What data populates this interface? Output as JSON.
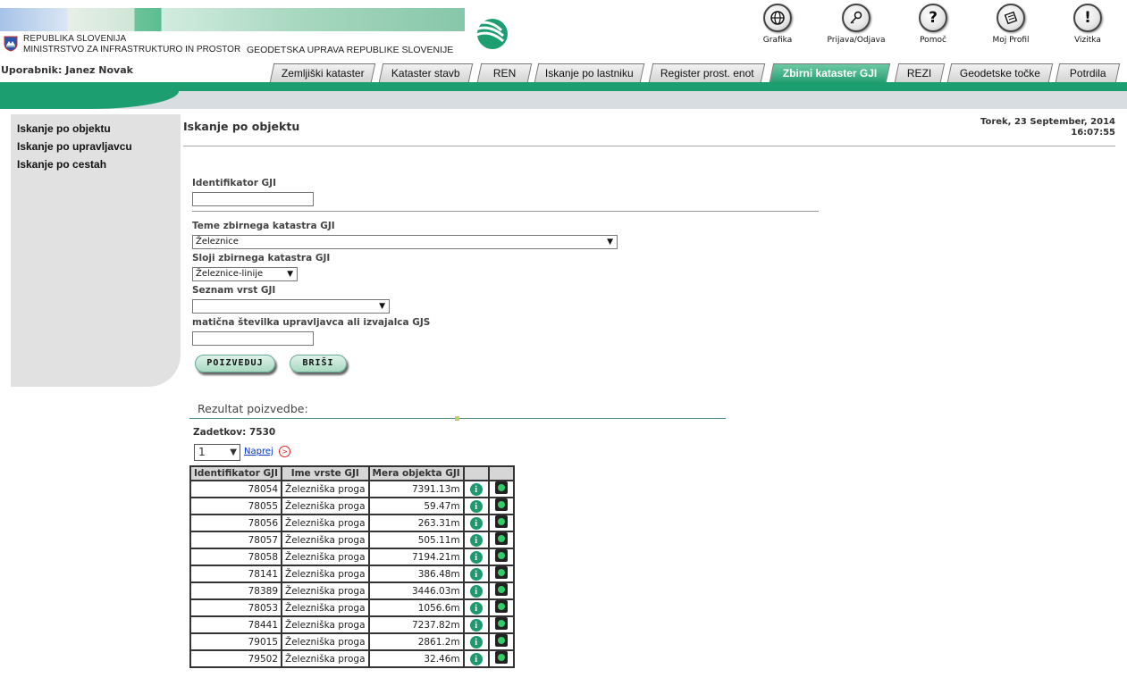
{
  "header": {
    "republic": "REPUBLIKA SLOVENIJA",
    "ministry": "MINISTRSTVO ZA INFRASTRUKTURO IN PROSTOR",
    "agency": "GEODETSKA UPRAVA REPUBLIKE SLOVENIJE",
    "top_icons": [
      {
        "label": "Grafika",
        "icon": "globe-icon"
      },
      {
        "label": "Prijava/Odjava",
        "icon": "key-icon"
      },
      {
        "label": "Pomoč",
        "icon": "help-icon",
        "glyph": "?"
      },
      {
        "label": "Moj Profil",
        "icon": "profile-icon"
      },
      {
        "label": "Vizitka",
        "icon": "info-icon",
        "glyph": "!"
      }
    ],
    "user": "Uporabnik: Janez Novak"
  },
  "tabs": [
    {
      "label": "Zemljiški kataster",
      "active": false
    },
    {
      "label": "Kataster stavb",
      "active": false
    },
    {
      "label": "REN",
      "active": false
    },
    {
      "label": "Iskanje po lastniku",
      "active": false
    },
    {
      "label": "Register prost. enot",
      "active": false
    },
    {
      "label": "Zbirni kataster GJI",
      "active": true
    },
    {
      "label": "REZI",
      "active": false
    },
    {
      "label": "Geodetske točke",
      "active": false
    },
    {
      "label": "Potrdila",
      "active": false
    }
  ],
  "sidebar": {
    "items": [
      "Iskanje po objektu",
      "Iskanje po upravljavcu",
      "Iskanje po cestah"
    ]
  },
  "main": {
    "title": "Iskanje po objektu",
    "date_line1": "Torek, 23 September, 2014",
    "date_line2": "16:07:55"
  },
  "form": {
    "identifikator_label": "Identifikator GJI",
    "identifikator_value": "",
    "teme_label": "Teme zbirnega katastra GJI",
    "teme_value": "Železnice",
    "sloji_label": "Sloji zbirnega katastra GJI",
    "sloji_value": "Železnice-linije",
    "vrste_label": "Seznam vrst GJI",
    "vrste_value": "",
    "maticna_label": "matična številka upravljavca ali izvajalca GJS",
    "maticna_value": "",
    "submit_label": "POIZVEDUJ",
    "clear_label": "BRIŠI"
  },
  "results": {
    "title": "Rezultat poizvedbe:",
    "count": "Zadetkov: 7530",
    "page": "1",
    "next_label": "Naprej",
    "columns": [
      "Identifikator GJI",
      "Ime vrste GJI",
      "Mera objekta GJI",
      "",
      ""
    ],
    "rows": [
      [
        "78054",
        "Železniška proga",
        "7391.13m"
      ],
      [
        "78055",
        "Železniška proga",
        "59.47m"
      ],
      [
        "78056",
        "Železniška proga",
        "263.31m"
      ],
      [
        "78057",
        "Železniška proga",
        "505.11m"
      ],
      [
        "78058",
        "Železniška proga",
        "7194.21m"
      ],
      [
        "78141",
        "Železniška proga",
        "386.48m"
      ],
      [
        "78389",
        "Železniška proga",
        "3446.03m"
      ],
      [
        "78053",
        "Železniška proga",
        "1056.6m"
      ],
      [
        "78441",
        "Železniška proga",
        "7237.82m"
      ],
      [
        "79015",
        "Železniška proga",
        "2861.2m"
      ],
      [
        "79502",
        "Železniška proga",
        "32.46m"
      ]
    ]
  },
  "colors": {
    "accent": "#1d9e70",
    "sidebar": "#e1e1e1"
  }
}
